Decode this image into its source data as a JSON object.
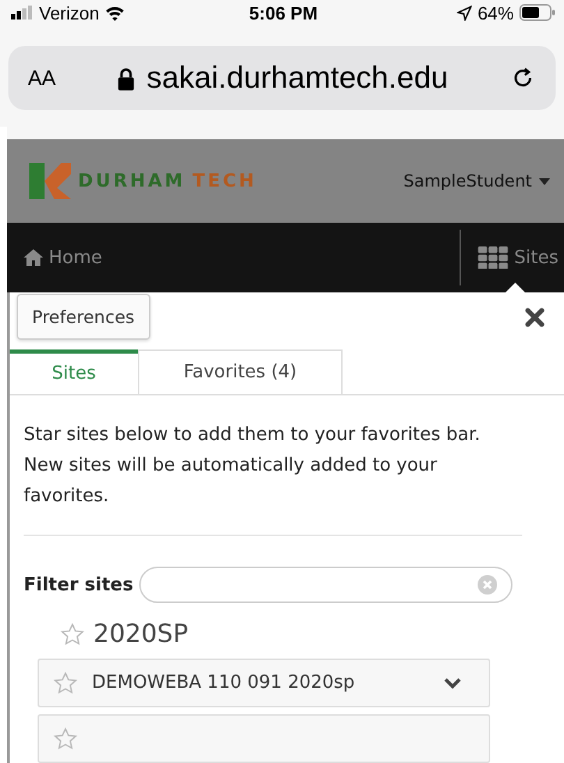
{
  "status_bar": {
    "carrier": "Verizon",
    "time": "5:06 PM",
    "battery": "64%"
  },
  "browser": {
    "text_size": "AA",
    "url": "sakai.durhamtech.edu"
  },
  "header": {
    "logo_words": [
      "DURHAM",
      "TECH"
    ],
    "user": "SampleStudent"
  },
  "nav": {
    "home": "Home",
    "sites": "Sites"
  },
  "panel": {
    "preferences_button": "Preferences",
    "tabs": [
      {
        "label": "Sites",
        "selected": true
      },
      {
        "label": "Favorites (4)",
        "selected": false
      }
    ],
    "intro": "Star sites below to add them to your favorites bar. New sites will be automatically added to your favorites.",
    "filter": {
      "label": "Filter sites"
    },
    "term": {
      "name": "2020SP",
      "favorite": false
    },
    "sites": [
      {
        "name": "DEMOWEBA 110 091 2020sp",
        "favorite": false,
        "expanded": false
      }
    ]
  }
}
